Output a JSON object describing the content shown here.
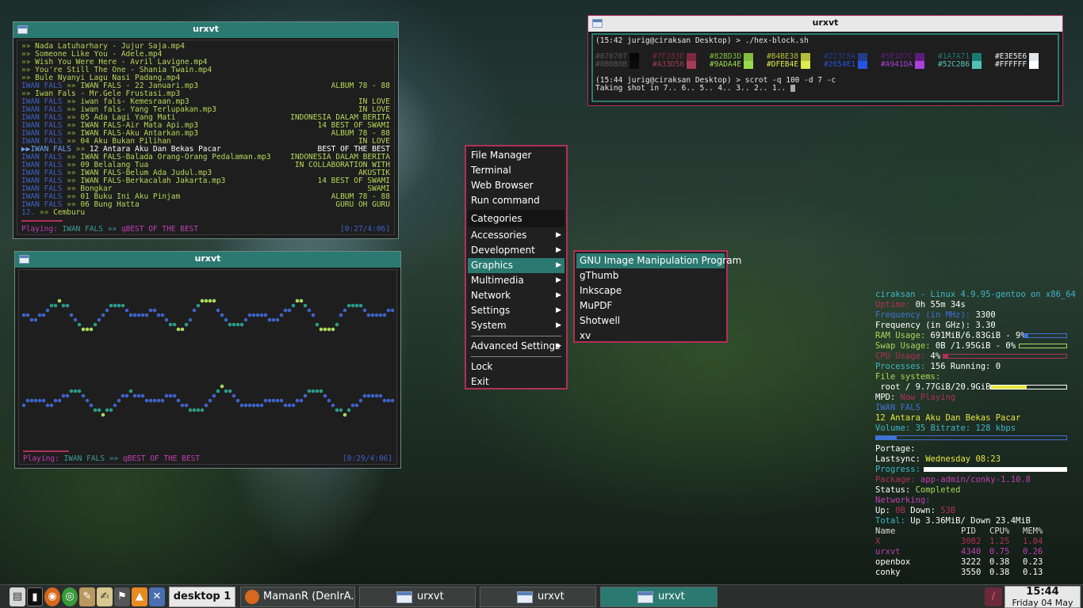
{
  "playlist_window": {
    "title": "urxvt",
    "rows": [
      {
        "artist": "",
        "prefix": " »» ",
        "title": "Nada Latuharhary - Jujur Saja.mp4",
        "album": ""
      },
      {
        "artist": "",
        "prefix": " »» ",
        "title": "Someone Like You - Adele.mp4",
        "album": ""
      },
      {
        "artist": "",
        "prefix": " »» ",
        "title": "Wish You Were Here - Avril Lavigne.mp4",
        "album": ""
      },
      {
        "artist": "",
        "prefix": " »» ",
        "title": "You're Still The One - Shania Twain.mp4",
        "album": ""
      },
      {
        "artist": "",
        "prefix": " »» ",
        "title": "Bule Nyanyi Lagu Nasi Padang.mp4",
        "album": ""
      },
      {
        "artist": "IWAN FALS",
        "prefix": " »» ",
        "title": "IWAN FALS - 22 Januari.mp3",
        "album": "ALBUM 78 - 88"
      },
      {
        "artist": "",
        "prefix": " »» ",
        "title": "Iwan Fals - Mr.Gele Frustasi.mp3",
        "album": ""
      },
      {
        "artist": "IWAN FALS",
        "prefix": " »» ",
        "title": "iwan fals- Kemesraan.mp3",
        "album": "IN LOVE"
      },
      {
        "artist": "IWAN FALS",
        "prefix": " »» ",
        "title": "iwan fals- Yang Terlupakan.mp3",
        "album": "IN LOVE"
      },
      {
        "artist": "IWAN FALS",
        "prefix": " »» ",
        "title": "05 Ada Lagi Yang Mati",
        "album": "INDONESIA DALAM BERITA"
      },
      {
        "artist": "IWAN FALS",
        "prefix": " »» ",
        "title": "IWAN FALS-Air Mata Api.mp3",
        "album": "14 BEST OF SWAMI"
      },
      {
        "artist": "IWAN FALS",
        "prefix": " »» ",
        "title": "IWAN FALS-Aku Antarkan.mp3",
        "album": "ALBUM 78 - 88"
      },
      {
        "artist": "IWAN FALS",
        "prefix": " »» ",
        "title": "04 Aku Bukan Pilihan",
        "album": "IN LOVE"
      },
      {
        "artist": "▶▶IWAN FALS",
        "prefix": " »» ",
        "title": "12 Antara Aku Dan Bekas Pacar",
        "album": "BEST OF THE BEST"
      },
      {
        "artist": "IWAN FALS",
        "prefix": " »» ",
        "title": "IWAN FALS-Balada Orang-Orang Pedalaman.mp3",
        "album": "INDONESIA DALAM BERITA"
      },
      {
        "artist": "IWAN FALS",
        "prefix": " »» ",
        "title": "09 Belalang Tua",
        "album": "IN COLLABORATION WITH"
      },
      {
        "artist": "IWAN FALS",
        "prefix": " »» ",
        "title": "IWAN FALS-Belum Ada Judul.mp3",
        "album": "AKUSTIK"
      },
      {
        "artist": "IWAN FALS",
        "prefix": " »» ",
        "title": "IWAN FALS-Berkacalah Jakarta.mp3",
        "album": "14 BEST OF SWAMI"
      },
      {
        "artist": "IWAN FALS",
        "prefix": " »» ",
        "title": "Bongkar",
        "album": "SWAMI"
      },
      {
        "artist": "IWAN FALS",
        "prefix": " »» ",
        "title": "01 Buku Ini Aku Pinjam",
        "album": "ALBUM 78 - 88"
      },
      {
        "artist": "IWAN FALS",
        "prefix": " »» ",
        "title": "06 Bung Hatta",
        "album": "GURU OH GURU"
      },
      {
        "artist": "12.",
        "prefix": " »» ",
        "title": "Cemburu",
        "album": ""
      }
    ],
    "status": {
      "label": "Playing:",
      "artist": "IWAN FALS",
      "sep": " »» ",
      "album": "qBEST OF THE BEST",
      "time": "[0:27/4:06]"
    },
    "progress": 0.11
  },
  "visualizer_window": {
    "title": "urxvt",
    "status": {
      "label": "Playing:",
      "artist": "IWAN FALS",
      "sep": " »» ",
      "album": "qBEST OF THE BEST",
      "time": "[0:29/4:06]"
    },
    "progress": 0.12
  },
  "hex_window": {
    "title": "urxvt",
    "line1": "(15:42 jurig@ciraksan Desktop) > ./hex-block.sh",
    "colors_row1": [
      {
        "hex": "#070707",
        "color": "#070707"
      },
      {
        "hex": "#7F283D",
        "color": "#7F283D"
      },
      {
        "hex": "#82BD3D",
        "color": "#82BD3D"
      },
      {
        "hex": "#B4BE38",
        "color": "#B4BE38"
      },
      {
        "hex": "#223C8A",
        "color": "#223C8A"
      },
      {
        "hex": "#5E1D7C",
        "color": "#5E1D7C"
      },
      {
        "hex": "#1A7A71",
        "color": "#1A7A71"
      },
      {
        "hex": "#E3E5E6",
        "color": "#E3E5E6"
      }
    ],
    "colors_row2": [
      {
        "hex": "#0B0B0B",
        "color": "#0B0B0B"
      },
      {
        "hex": "#A33D56",
        "color": "#A33D56"
      },
      {
        "hex": "#9ADA4E",
        "color": "#9ADA4E"
      },
      {
        "hex": "#DFEB4E",
        "color": "#DFEB4E"
      },
      {
        "hex": "#2654E1",
        "color": "#2654E1"
      },
      {
        "hex": "#A941DA",
        "color": "#A941DA"
      },
      {
        "hex": "#52C2B6",
        "color": "#52C2B6"
      },
      {
        "hex": "#FFFFFF",
        "color": "#FFFFFF"
      }
    ],
    "line3": "(15:44 jurig@ciraksan Desktop) > scrot -q 100 -d 7 -c",
    "line4": "Taking shot in 7.. 6.. 5.. 4.. 3.. 2.. 1.."
  },
  "menu": {
    "top_items": [
      "File Manager",
      "Terminal",
      "Web Browser",
      "Run command"
    ],
    "categories_header": "Categories",
    "category_items": [
      "Accessories",
      "Development",
      "Graphics",
      "Multimedia",
      "Network",
      "Settings",
      "System"
    ],
    "advanced": "Advanced Settings",
    "bottom_items": [
      "Lock",
      "Exit"
    ],
    "submenu_arrow": "▶"
  },
  "graphics_submenu": {
    "items": [
      "GNU Image Manipulation Program",
      "gThumb",
      "Inkscape",
      "MuPDF",
      "Shotwell",
      "xv"
    ]
  },
  "conky": {
    "header": "ciraksan - Linux 4.9.95-gentoo on x86_64",
    "uptime_label": "Uptime:",
    "uptime": "0h 55m 34s",
    "freq_mhz_label": "Frequency (in MHz):",
    "freq_mhz": "3300",
    "freq_ghz_label": "Frequency (in GHz):",
    "freq_ghz": "3.30",
    "ram_label": "RAM Usage:",
    "ram": "691MiB/6.83GiB - 9%",
    "ram_pct": 0.09,
    "swap_label": "Swap Usage:",
    "swap": "0B  /1.95GiB - 0%",
    "swap_pct": 0.0,
    "cpu_label": "CPU Usage:",
    "cpu": "4%",
    "cpu_pct": 0.04,
    "proc_label": "Processes:",
    "proc": "156",
    "running_label": "Running:",
    "running": "0",
    "fs_label": "File systems:",
    "fs_root": "root / 9.77GiB/20.9GiB",
    "fs_pct": 0.47,
    "mpd_label": "MPD:",
    "mpd_state": "Now Playing",
    "mpd_artist": "IWAN FALS",
    "mpd_title": "12 Antara Aku Dan Bekas Pacar",
    "mpd_volume_label": "Volume:",
    "mpd_volume": "35",
    "mpd_bitrate_label": "Bitrate:",
    "mpd_bitrate": "128 kbps",
    "mpd_progress": 0.11,
    "portage_label": "Portage:",
    "lastsync_label": "Lastsync:",
    "lastsync": "Wednesday 08:23",
    "progress_label": "Progress:",
    "portage_progress": 1.0,
    "package_label": "Package:",
    "package": "app-admin/conky-1.10.8",
    "status_label": "Status:",
    "status": "Completed",
    "net_label": "Networking:",
    "up_label": "Up:",
    "up": "0B",
    "down_label": "Down:",
    "down": "53B",
    "total_label": "Total:",
    "total": "Up 3.36MiB/ Down 23.4MiB",
    "proc_table": {
      "headers": [
        "Name",
        "PID",
        "CPU%",
        "MEM%"
      ],
      "rows": [
        {
          "name": "X",
          "pid": "3082",
          "cpu": "1.25",
          "mem": "1.04"
        },
        {
          "name": "urxvt",
          "pid": "4340",
          "cpu": "0.75",
          "mem": "0.26"
        },
        {
          "name": "openbox",
          "pid": "3222",
          "cpu": "0.38",
          "mem": "0.23"
        },
        {
          "name": "conky",
          "pid": "3550",
          "cpu": "0.38",
          "mem": "0.13"
        }
      ]
    }
  },
  "taskbar": {
    "desktop": "desktop 1",
    "tasks": [
      {
        "label": "MamanR (DenIrA..."
      },
      {
        "label": "urxvt"
      },
      {
        "label": "urxvt"
      },
      {
        "label": "urxvt"
      }
    ],
    "clock_time": "15:44",
    "clock_date": "Friday 04 May"
  },
  "colors": {
    "accent": "#2b7a72",
    "menu_border": "#b0305a"
  }
}
